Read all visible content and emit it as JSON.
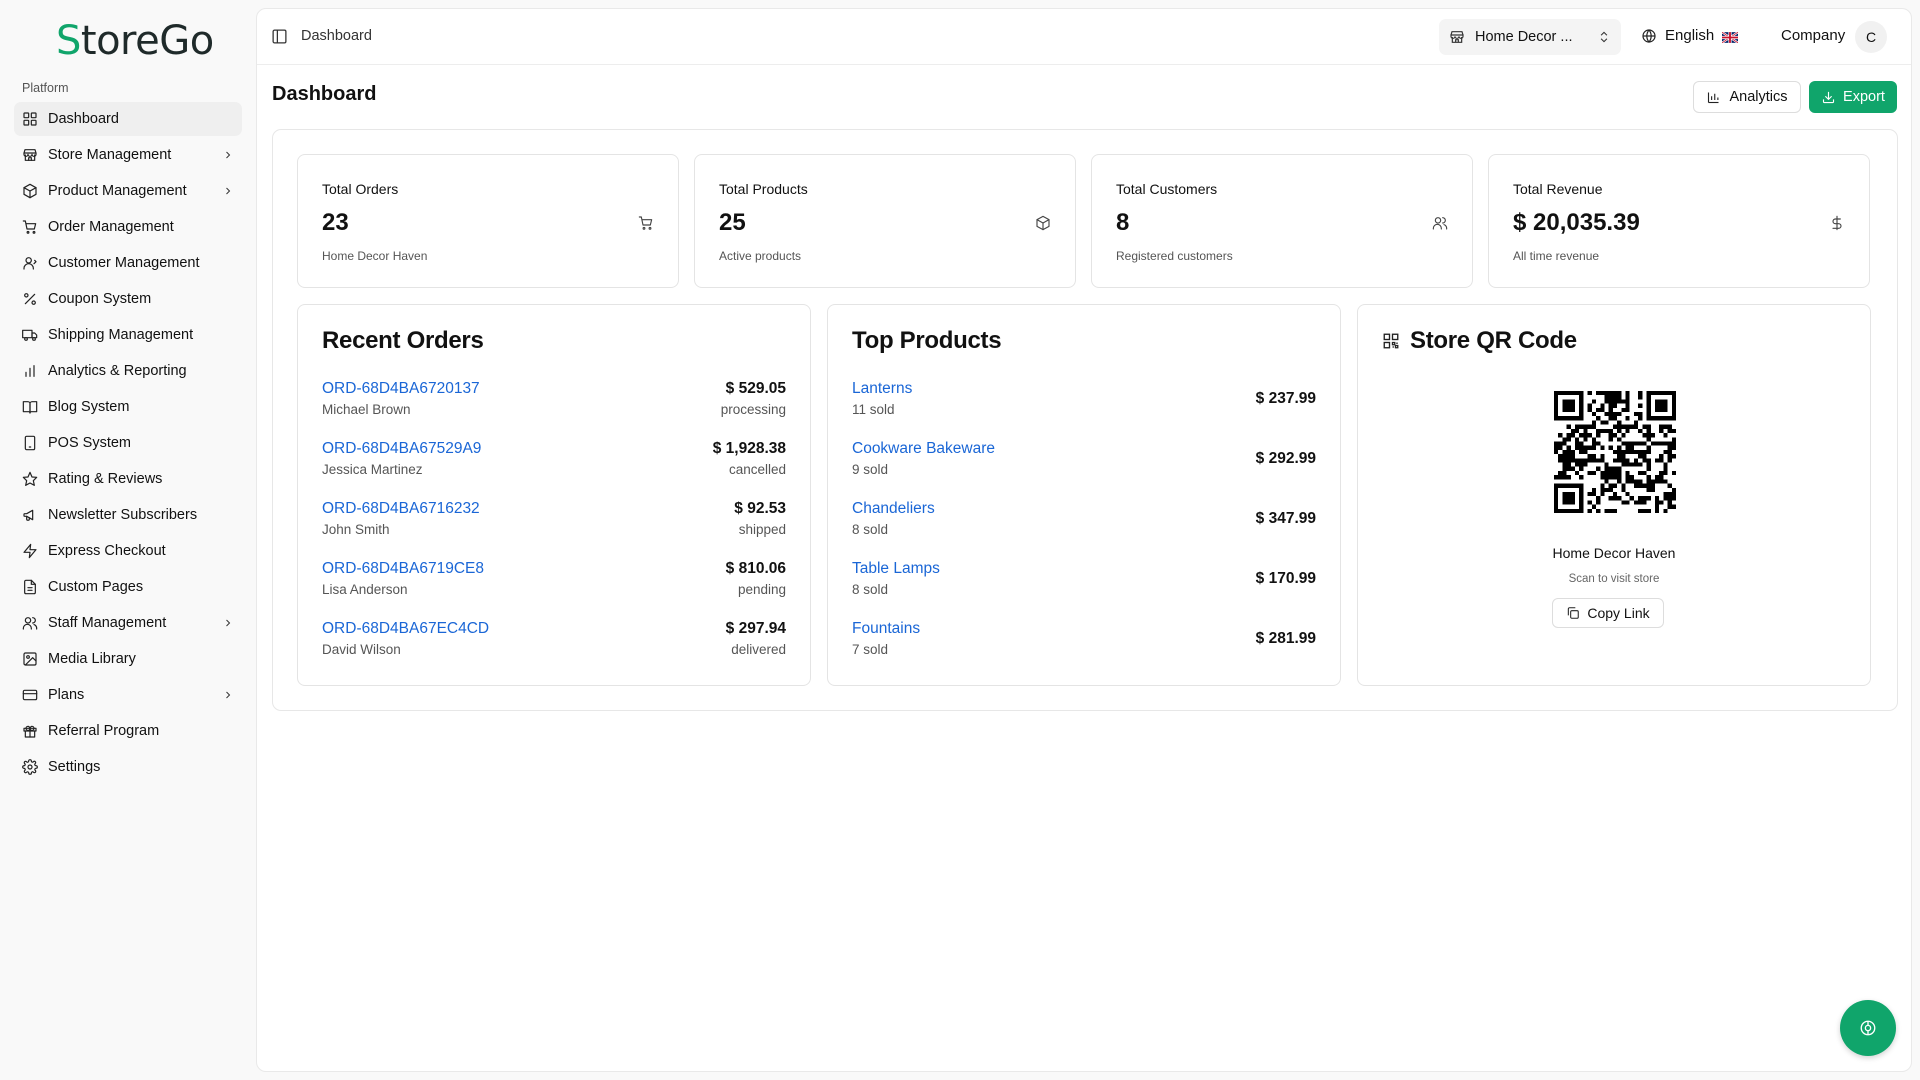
{
  "brand": {
    "logo_accent": "S",
    "logo_rest": "toreGo",
    "accent_color": "#10a56b"
  },
  "sidebar": {
    "section": "Platform",
    "items": [
      {
        "label": "Dashboard",
        "icon": "grid-icon",
        "active": true
      },
      {
        "label": "Store Management",
        "icon": "store-icon",
        "chevron": true
      },
      {
        "label": "Product Management",
        "icon": "package-icon",
        "chevron": true
      },
      {
        "label": "Order Management",
        "icon": "cart-icon"
      },
      {
        "label": "Customer Management",
        "icon": "user-icon"
      },
      {
        "label": "Coupon System",
        "icon": "percent-icon"
      },
      {
        "label": "Shipping Management",
        "icon": "truck-icon"
      },
      {
        "label": "Analytics & Reporting",
        "icon": "bar-chart-icon"
      },
      {
        "label": "Blog System",
        "icon": "book-icon"
      },
      {
        "label": "POS System",
        "icon": "tablet-icon"
      },
      {
        "label": "Rating & Reviews",
        "icon": "star-icon"
      },
      {
        "label": "Newsletter Subscribers",
        "icon": "megaphone-icon"
      },
      {
        "label": "Express Checkout",
        "icon": "zap-icon"
      },
      {
        "label": "Custom Pages",
        "icon": "file-icon"
      },
      {
        "label": "Staff Management",
        "icon": "users-icon",
        "chevron": true
      },
      {
        "label": "Media Library",
        "icon": "image-icon"
      },
      {
        "label": "Plans",
        "icon": "credit-card-icon",
        "chevron": true
      },
      {
        "label": "Referral Program",
        "icon": "gift-icon"
      },
      {
        "label": "Settings",
        "icon": "gear-icon"
      }
    ]
  },
  "header": {
    "breadcrumb": "Dashboard",
    "store_select": "Home Decor ...",
    "language": "English",
    "company": "Company",
    "avatar_initial": "C"
  },
  "page": {
    "title": "Dashboard",
    "analytics_label": "Analytics",
    "export_label": "Export"
  },
  "stats": [
    {
      "label": "Total Orders",
      "value": "23",
      "sub": "Home Decor Haven",
      "icon": "cart-icon"
    },
    {
      "label": "Total Products",
      "value": "25",
      "sub": "Active products",
      "icon": "package-icon"
    },
    {
      "label": "Total Customers",
      "value": "8",
      "sub": "Registered customers",
      "icon": "users-icon"
    },
    {
      "label": "Total Revenue",
      "value": "$ 20,035.39",
      "sub": "All time revenue",
      "icon": "dollar-icon"
    }
  ],
  "recent_orders": {
    "title": "Recent Orders",
    "rows": [
      {
        "id": "ORD-68D4BA6720137",
        "customer": "Michael Brown",
        "amount": "$ 529.05",
        "status": "processing"
      },
      {
        "id": "ORD-68D4BA67529A9",
        "customer": "Jessica Martinez",
        "amount": "$ 1,928.38",
        "status": "cancelled"
      },
      {
        "id": "ORD-68D4BA6716232",
        "customer": "John Smith",
        "amount": "$ 92.53",
        "status": "shipped"
      },
      {
        "id": "ORD-68D4BA6719CE8",
        "customer": "Lisa Anderson",
        "amount": "$ 810.06",
        "status": "pending"
      },
      {
        "id": "ORD-68D4BA67EC4CD",
        "customer": "David Wilson",
        "amount": "$ 297.94",
        "status": "delivered"
      }
    ]
  },
  "top_products": {
    "title": "Top Products",
    "rows": [
      {
        "name": "Lanterns",
        "sold": "11 sold",
        "price": "$ 237.99"
      },
      {
        "name": "Cookware Bakeware",
        "sold": "9 sold",
        "price": "$ 292.99"
      },
      {
        "name": "Chandeliers",
        "sold": "8 sold",
        "price": "$ 347.99"
      },
      {
        "name": "Table Lamps",
        "sold": "8 sold",
        "price": "$ 170.99"
      },
      {
        "name": "Fountains",
        "sold": "7 sold",
        "price": "$ 281.99"
      }
    ]
  },
  "qr": {
    "title": "Store QR Code",
    "store_name": "Home Decor Haven",
    "scan_text": "Scan to visit store",
    "copy_label": "Copy Link"
  }
}
